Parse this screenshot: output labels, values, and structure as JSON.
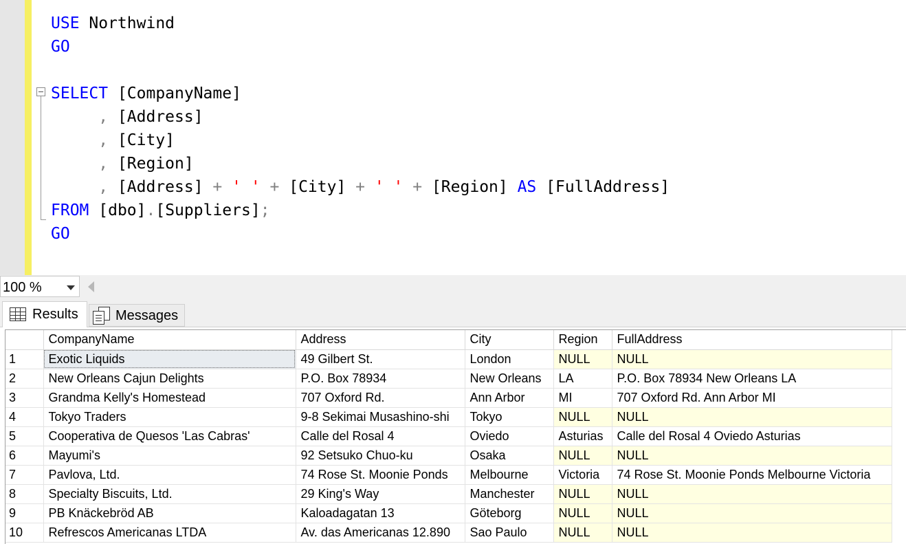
{
  "editor": {
    "lines": [
      [
        {
          "t": "USE ",
          "c": "kw"
        },
        {
          "t": "Northwind",
          "c": ""
        }
      ],
      [
        {
          "t": "GO",
          "c": "kw"
        }
      ],
      [],
      [
        {
          "t": "SELECT ",
          "c": "kw"
        },
        {
          "t": "[CompanyName]",
          "c": ""
        }
      ],
      [
        {
          "t": "     , ",
          "c": "op"
        },
        {
          "t": "[Address]",
          "c": ""
        }
      ],
      [
        {
          "t": "     , ",
          "c": "op"
        },
        {
          "t": "[City]",
          "c": ""
        }
      ],
      [
        {
          "t": "     , ",
          "c": "op"
        },
        {
          "t": "[Region]",
          "c": ""
        }
      ],
      [
        {
          "t": "     , ",
          "c": "op"
        },
        {
          "t": "[Address] ",
          "c": ""
        },
        {
          "t": "+ ",
          "c": "op"
        },
        {
          "t": "' ' ",
          "c": "str"
        },
        {
          "t": "+ ",
          "c": "op"
        },
        {
          "t": "[City] ",
          "c": ""
        },
        {
          "t": "+ ",
          "c": "op"
        },
        {
          "t": "' ' ",
          "c": "str"
        },
        {
          "t": "+ ",
          "c": "op"
        },
        {
          "t": "[Region] ",
          "c": ""
        },
        {
          "t": "AS ",
          "c": "kw"
        },
        {
          "t": "[FullAddress]",
          "c": ""
        }
      ],
      [
        {
          "t": "FROM ",
          "c": "kw"
        },
        {
          "t": "[dbo]",
          "c": ""
        },
        {
          "t": ".",
          "c": "op"
        },
        {
          "t": "[Suppliers]",
          "c": ""
        },
        {
          "t": ";",
          "c": "op"
        }
      ],
      [
        {
          "t": "GO",
          "c": "kw"
        }
      ]
    ]
  },
  "zoom": {
    "value": "100 %"
  },
  "tabs": {
    "results": "Results",
    "messages": "Messages"
  },
  "results": {
    "columns": [
      "",
      "CompanyName",
      "Address",
      "City",
      "Region",
      "FullAddress"
    ],
    "rows": [
      [
        "1",
        "Exotic Liquids",
        "49 Gilbert St.",
        "London",
        "NULL",
        "NULL"
      ],
      [
        "2",
        "New Orleans Cajun Delights",
        "P.O. Box 78934",
        "New Orleans",
        "LA",
        "P.O. Box 78934 New Orleans LA"
      ],
      [
        "3",
        "Grandma Kelly's Homestead",
        "707 Oxford Rd.",
        "Ann Arbor",
        "MI",
        "707 Oxford Rd. Ann Arbor MI"
      ],
      [
        "4",
        "Tokyo Traders",
        "9-8 Sekimai Musashino-shi",
        "Tokyo",
        "NULL",
        "NULL"
      ],
      [
        "5",
        "Cooperativa de Quesos 'Las Cabras'",
        "Calle del Rosal 4",
        "Oviedo",
        "Asturias",
        "Calle del Rosal 4 Oviedo Asturias"
      ],
      [
        "6",
        "Mayumi's",
        "92 Setsuko Chuo-ku",
        "Osaka",
        "NULL",
        "NULL"
      ],
      [
        "7",
        "Pavlova, Ltd.",
        "74 Rose St. Moonie Ponds",
        "Melbourne",
        "Victoria",
        "74 Rose St. Moonie Ponds Melbourne Victoria"
      ],
      [
        "8",
        "Specialty Biscuits, Ltd.",
        "29 King's Way",
        "Manchester",
        "NULL",
        "NULL"
      ],
      [
        "9",
        "PB Knäckebröd AB",
        "Kaloadagatan 13",
        "Göteborg",
        "NULL",
        "NULL"
      ],
      [
        "10",
        "Refrescos Americanas LTDA",
        "Av. das Americanas 12.890",
        "Sao Paulo",
        "NULL",
        "NULL"
      ]
    ]
  }
}
